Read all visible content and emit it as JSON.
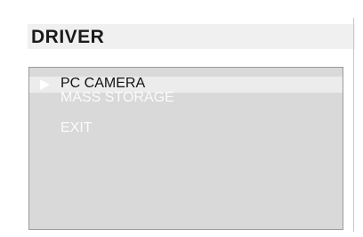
{
  "header": {
    "title": "DRIVER"
  },
  "menu": {
    "items": [
      {
        "label": "PC CAMERA",
        "selected": true
      },
      {
        "label": "MASS STORAGE",
        "selected": false
      },
      {
        "label": "EXIT",
        "selected": false
      }
    ],
    "selection_indicator_icon": "right-triangle-pointer"
  },
  "colors": {
    "panel": "#d9d9d9",
    "title_bar": "#f0f0f0",
    "highlight": "#ececec",
    "selected_text": "#111111",
    "unselected_text": "#ffffff"
  }
}
